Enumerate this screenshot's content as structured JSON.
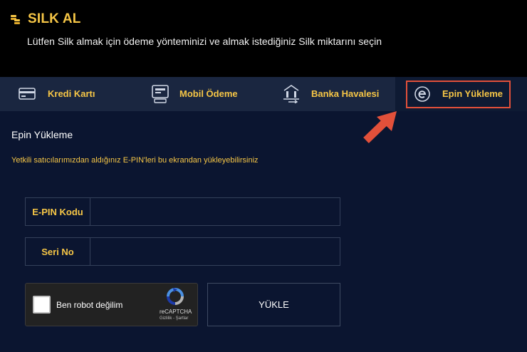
{
  "header": {
    "title": "SILK AL",
    "subtitle": "Lütfen Silk almak için ödeme yönteminizi ve almak istediğiniz Silk miktarını seçin",
    "icon": "coins-icon"
  },
  "tabs": [
    {
      "label": "Kredi Kartı",
      "icon": "credit-card-icon",
      "active": false
    },
    {
      "label": "Mobil Ödeme",
      "icon": "mobile-payment-icon",
      "active": false
    },
    {
      "label": "Banka Havalesi",
      "icon": "bank-transfer-icon",
      "active": false
    },
    {
      "label": "Epin Yükleme",
      "icon": "epin-icon",
      "active": true
    }
  ],
  "main": {
    "section_title": "Epin Yükleme",
    "info": "Yetkili satıcılarımızdan aldığınız E-PIN'leri bu ekrandan yükleyebilirsiniz",
    "fields": {
      "epin": {
        "label": "E-PIN Kodu",
        "value": ""
      },
      "seri": {
        "label": "Seri No",
        "value": ""
      }
    },
    "captcha": {
      "text": "Ben robot değilim",
      "brand": "reCAPTCHA",
      "terms": "Gizlilik - Şartlar"
    },
    "submit_label": "YÜKLE"
  },
  "colors": {
    "accent": "#f6c646",
    "header_bg": "#000000",
    "tabs_bg": "#1a2640",
    "active_tab_bg": "#0e1a33",
    "panel_bg": "#0b1530",
    "annotation": "#e2503a"
  }
}
